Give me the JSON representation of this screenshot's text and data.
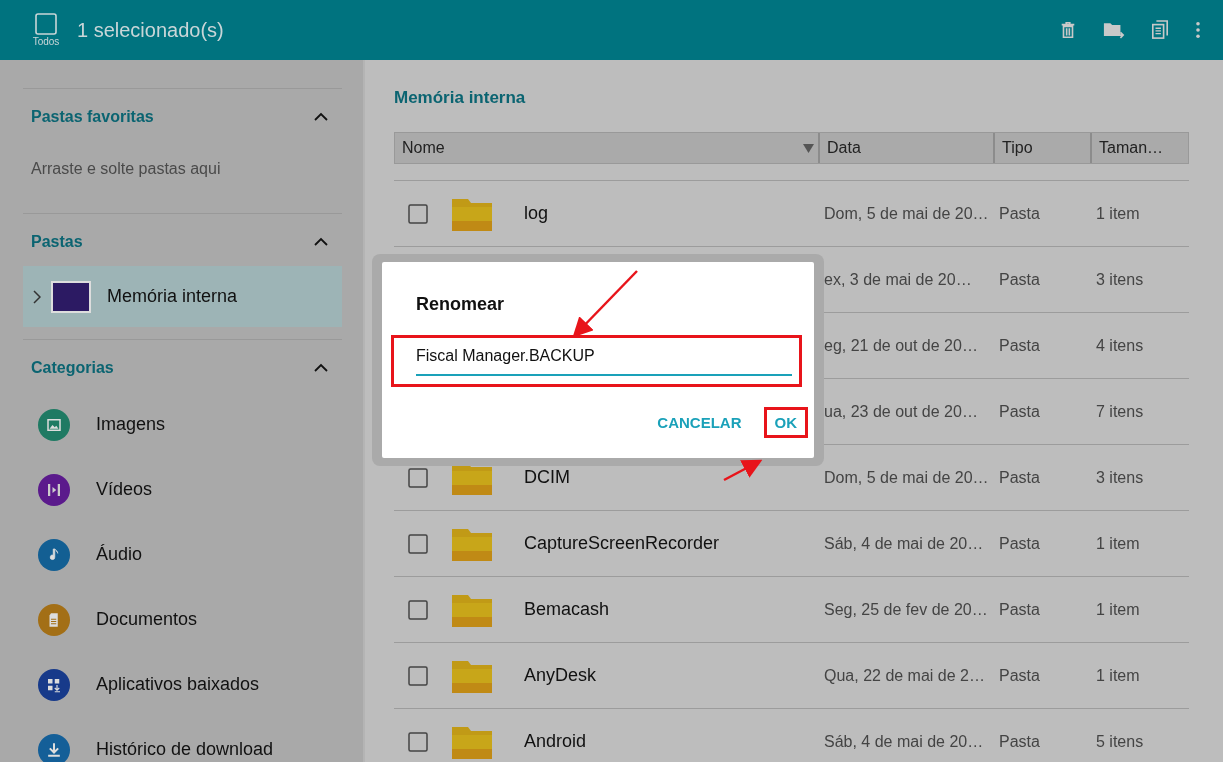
{
  "top_bar": {
    "select_all_label": "Todos",
    "select_all_checked": false,
    "title": "1 selecionado(s)"
  },
  "sidebar": {
    "sections": [
      {
        "title": "Pastas favoritas",
        "expanded": true,
        "kind": "hint",
        "hint": "Arraste e solte pastas aqui"
      },
      {
        "title": "Pastas",
        "expanded": true,
        "kind": "folders",
        "items": [
          {
            "label": "Memória interna",
            "selected": true,
            "expanded": false
          }
        ]
      },
      {
        "title": "Categorias",
        "expanded": true,
        "kind": "categories",
        "items": [
          {
            "label": "Imagens",
            "color": "#1f7a63"
          },
          {
            "label": "Vídeos",
            "color": "#5b1a8c"
          },
          {
            "label": "Áudio",
            "color": "#135f93"
          },
          {
            "label": "Documentos",
            "color": "#a36f16"
          },
          {
            "label": "Aplicativos baixados",
            "color": "#173a8a"
          },
          {
            "label": "Histórico de download",
            "color": "#145f98"
          }
        ]
      }
    ]
  },
  "main": {
    "title": "Memória interna",
    "table": {
      "columns": [
        {
          "label": "Nome",
          "sorted": true
        },
        {
          "label": "Data",
          "sorted": false
        },
        {
          "label": "Tipo",
          "sorted": false
        },
        {
          "label": "Taman…",
          "sorted": false
        }
      ],
      "rows": [
        {
          "name": "log",
          "date": "Dom, 5 de mai de 20…",
          "type": "Pasta",
          "size": "1 item",
          "checked": false
        },
        {
          "date": "ex, 3 de mai de 20…",
          "type": "Pasta",
          "size": "3 itens"
        },
        {
          "date": "eg, 21 de out de 20…",
          "type": "Pasta",
          "size": "4 itens"
        },
        {
          "date": "ua, 23 de out de 20…",
          "type": "Pasta",
          "size": "7 itens"
        },
        {
          "name": "DCIM",
          "date": "Dom, 5 de mai de 20…",
          "type": "Pasta",
          "size": "3 itens",
          "checked": false
        },
        {
          "name": "CaptureScreenRecorder",
          "date": "Sáb, 4 de mai de 20…",
          "type": "Pasta",
          "size": "1 item",
          "checked": false
        },
        {
          "name": "Bemacash",
          "date": "Seg, 25 de fev de 20…",
          "type": "Pasta",
          "size": "1 item",
          "checked": false
        },
        {
          "name": "AnyDesk",
          "date": "Qua, 22 de mai de 2…",
          "type": "Pasta",
          "size": "1 item",
          "checked": false
        },
        {
          "name": "Android",
          "date": "Sáb, 4 de mai de 20…",
          "type": "Pasta",
          "size": "5 itens",
          "checked": false
        }
      ]
    }
  },
  "dialog": {
    "title": "Renomear",
    "value": "Fiscal Manager.BACKUP",
    "buttons": [
      "CANCELAR",
      "OK"
    ]
  }
}
